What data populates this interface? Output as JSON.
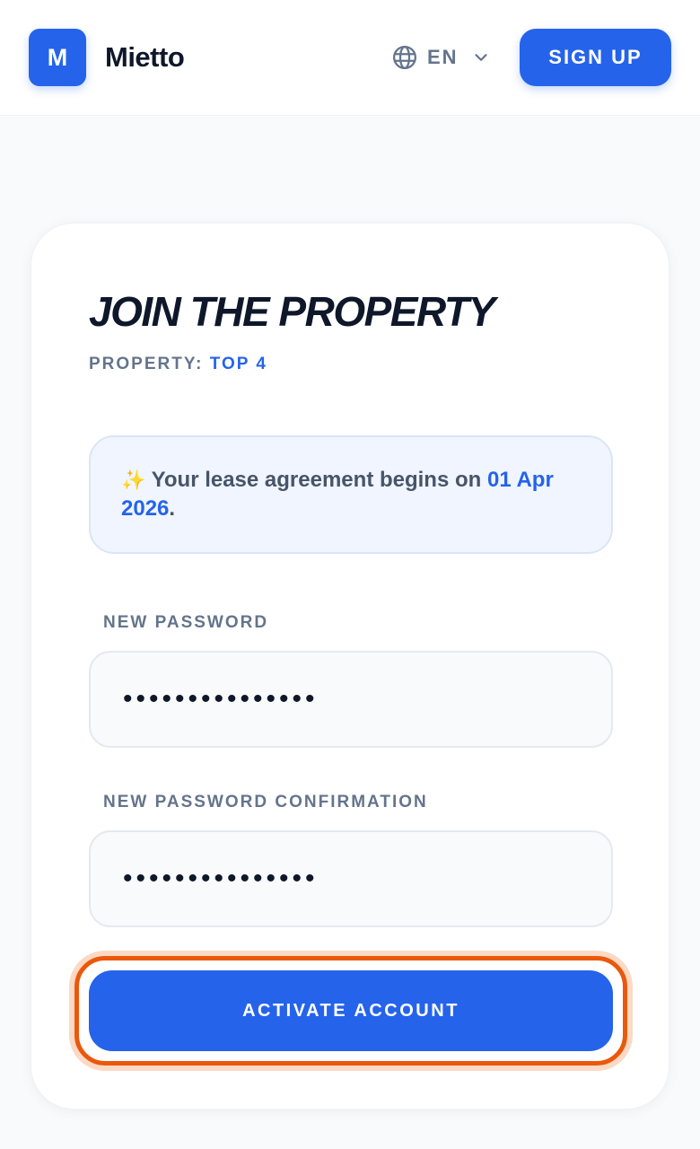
{
  "header": {
    "logo_letter": "M",
    "brand_name": "Mietto",
    "language": "EN",
    "signup_label": "SIGN UP"
  },
  "card": {
    "title": "JOIN THE PROPERTY",
    "property_label": "PROPERTY:",
    "property_value": "TOP 4",
    "notice_icon": "✨",
    "notice_text": "Your lease agreement begins on",
    "notice_date": "01 Apr 2026",
    "notice_end": ".",
    "password_label": "NEW PASSWORD",
    "password_value": "•••••••••••••••",
    "confirmation_label": "NEW PASSWORD CONFIRMATION",
    "confirmation_value": "•••••••••••••••",
    "activate_label": "ACTIVATE ACCOUNT"
  },
  "colors": {
    "primary": "#2563eb",
    "highlight_ring": "#ea580c"
  },
  "icons": {
    "language": "globe-icon",
    "language_dropdown": "chevron-down-icon",
    "notice": "sparkles-icon"
  }
}
